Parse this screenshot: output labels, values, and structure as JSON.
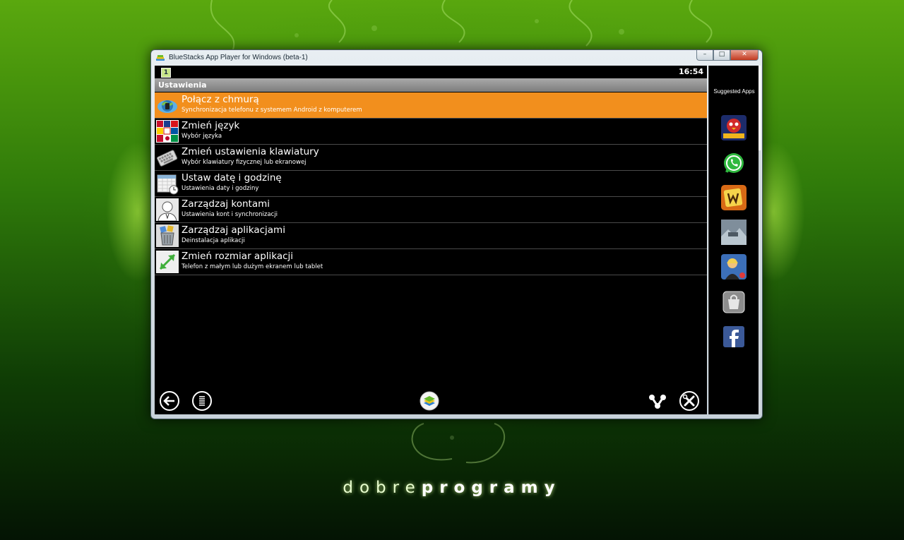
{
  "window": {
    "title": "BlueStacks App Player for Windows (beta-1)",
    "controls": {
      "minimize": "–",
      "maximize": "□",
      "close": "✕"
    }
  },
  "statusbar": {
    "notification": "1",
    "time": "16:54"
  },
  "header": {
    "title": "Ustawienia"
  },
  "settings": [
    {
      "title": "Połącz z chmurą",
      "subtitle": "Synchronizacja telefonu z systemem Android z komputerem",
      "icon": "cloud-sync-icon",
      "selected": true
    },
    {
      "title": "Zmień język",
      "subtitle": "Wybór języka",
      "icon": "flags-language-icon"
    },
    {
      "title": "Zmień ustawienia klawiatury",
      "subtitle": "Wybór klawiatury fizycznej lub ekranowej",
      "icon": "keyboard-icon"
    },
    {
      "title": "Ustaw datę i godzinę",
      "subtitle": "Ustawienia daty i godziny",
      "icon": "calendar-icon"
    },
    {
      "title": "Zarządzaj kontami",
      "subtitle": "Ustawienia kont i synchronizacji",
      "icon": "account-icon"
    },
    {
      "title": "Zarządzaj aplikacjami",
      "subtitle": "Deinstalacja aplikacji",
      "icon": "apps-trash-icon"
    },
    {
      "title": "Zmień rozmiar aplikacji",
      "subtitle": "Telefon z małym lub dużym ekranem lub tablet",
      "icon": "resize-arrow-icon"
    }
  ],
  "navbar": {
    "buttons": [
      "back-icon",
      "menu-icon",
      "bluestacks-home-icon",
      "share-icon",
      "settings-tools-icon"
    ]
  },
  "sidebar": {
    "title": "Suggested Apps",
    "apps": [
      "angry-birds-space-icon",
      "whatsapp-icon",
      "words-with-friends-icon",
      "game-screenshot-icon",
      "hidden-object-game-icon",
      "app-store-bag-icon",
      "facebook-icon"
    ]
  },
  "brand": {
    "light": "dobre",
    "bold": "programy"
  },
  "colors": {
    "selected_row": "#f28f1d",
    "header": "#8f8f8f",
    "background": "#2f7a0a"
  }
}
